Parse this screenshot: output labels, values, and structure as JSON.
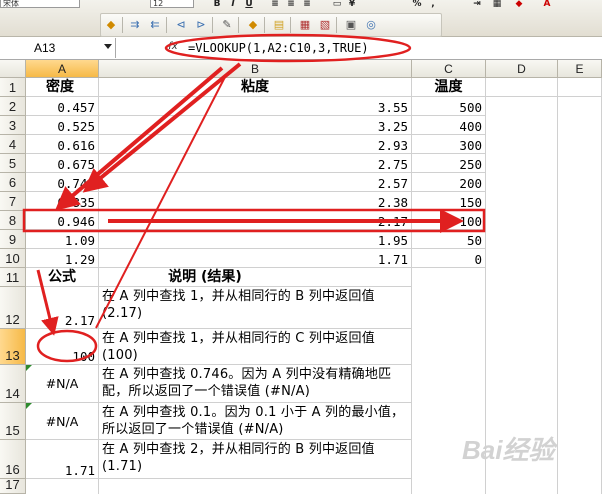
{
  "toolbar": {
    "font_name": "宋体",
    "font_size": "12",
    "bold": "B",
    "italic": "I",
    "underline": "U",
    "percent": "%",
    "comma": ","
  },
  "formula_bar": {
    "name_box": "A13",
    "fx": "fx",
    "formula": "=VLOOKUP(1,A2:C10,3,TRUE)"
  },
  "columns": [
    "A",
    "B",
    "C",
    "D",
    "E"
  ],
  "rows": [
    "1",
    "2",
    "3",
    "4",
    "5",
    "6",
    "7",
    "8",
    "9",
    "10",
    "11",
    "12",
    "13",
    "14",
    "15",
    "16",
    "17"
  ],
  "headers": {
    "a": "密度",
    "b": "粘度",
    "c": "温度"
  },
  "data": [
    {
      "a": "0.457",
      "b": "3.55",
      "c": "500"
    },
    {
      "a": "0.525",
      "b": "3.25",
      "c": "400"
    },
    {
      "a": "0.616",
      "b": "2.93",
      "c": "300"
    },
    {
      "a": "0.675",
      "b": "2.75",
      "c": "250"
    },
    {
      "a": "0.746",
      "b": "2.57",
      "c": "200"
    },
    {
      "a": "0.835",
      "b": "2.38",
      "c": "150"
    },
    {
      "a": "0.946",
      "b": "2.17",
      "c": "100"
    },
    {
      "a": "1.09",
      "b": "1.95",
      "c": "50"
    },
    {
      "a": "1.29",
      "b": "1.71",
      "c": "0"
    }
  ],
  "lower_headers": {
    "formula": "公式",
    "desc": "说明 (结果)"
  },
  "examples": [
    {
      "value": "2.17",
      "desc": "在 A 列中查找 1，并从相同行的 B 列中返回值 (2.17)"
    },
    {
      "value": "100",
      "desc": "在 A 列中查找 1，并从相同行的 C 列中返回值 (100)"
    },
    {
      "value": "#N/A",
      "desc": "在 A 列中查找 0.746。因为 A 列中没有精确地匹配，所以返回了一个错误值 (#N/A)"
    },
    {
      "value": "#N/A",
      "desc": "在 A 列中查找 0.1。因为 0.1 小于 A 列的最小值，所以返回了一个错误值 (#N/A)"
    },
    {
      "value": "1.71",
      "desc": "在 A 列中查找 2，并从相同行的 B 列中返回值 (1.71)"
    }
  ],
  "colors": {
    "annotation": "#e02020",
    "active_header": "#f6b947",
    "error_indicator": "#2e8b2e"
  },
  "watermark": "Bai经验"
}
